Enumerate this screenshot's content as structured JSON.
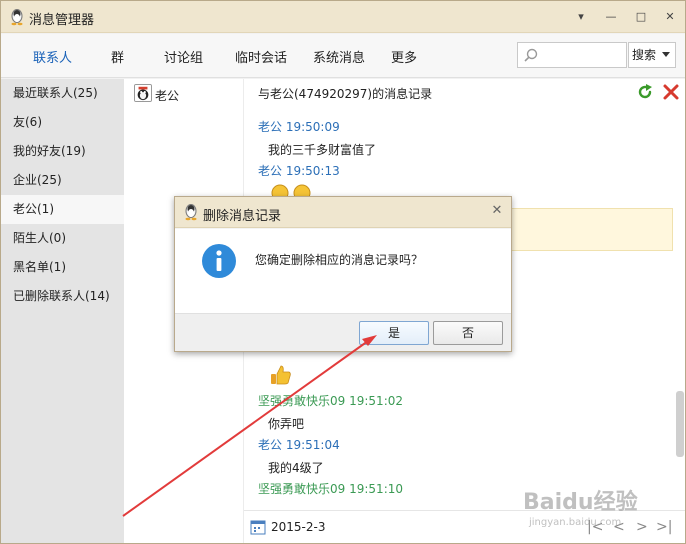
{
  "window": {
    "title": "消息管理器",
    "controls": {
      "dropdown": "▾",
      "minimize": "—",
      "maximize": "□",
      "close": "✕"
    }
  },
  "nav": {
    "tabs": [
      "联系人",
      "群",
      "讨论组",
      "临时会话",
      "系统消息",
      "更多"
    ],
    "active_tab": "联系人",
    "search_placeholder": "",
    "search_button": "搜索"
  },
  "sidebar": {
    "items": [
      "最近联系人(25)",
      "友(6)",
      "我的好友(19)",
      "企业(25)",
      "老公(1)",
      "陌生人(0)",
      "黑名单(1)",
      "已删除联系人(14)"
    ],
    "selected": "老公(1)"
  },
  "contacts": [
    {
      "name": "老公"
    }
  ],
  "chat": {
    "header": "与老公(474920297)的消息记录",
    "messages": [
      {
        "sender": "老公",
        "time": "19:50:09",
        "text": "我的三千多财富值了",
        "color": "#2c6fb7"
      },
      {
        "sender": "老公",
        "time": "19:50:13",
        "text": "",
        "emoji": "gift",
        "color": "#2c6fb7"
      },
      {
        "sender": "",
        "time": "",
        "text": "",
        "emoji": "thumbs-up",
        "color": ""
      },
      {
        "sender": "坚强勇敢快乐09",
        "time": "19:51:02",
        "text": "你弄吧",
        "color": "#3b9a54"
      },
      {
        "sender": "老公",
        "time": "19:51:04",
        "text": "我的4级了",
        "color": "#2c6fb7"
      },
      {
        "sender": "坚强勇敢快乐09",
        "time": "19:51:10",
        "text": "",
        "color": "#3b9a54"
      }
    ],
    "footer_date": "2015-2-3",
    "pager": {
      "first": "|<",
      "prev": "<",
      "next": ">",
      "last": ">|"
    }
  },
  "dialog": {
    "title": "删除消息记录",
    "close": "✕",
    "message": "您确定删除相应的消息记录吗？",
    "yes_label": "是",
    "no_label": "否"
  },
  "watermark": {
    "main": "Baidu经验",
    "sub": "jingyan.baidu.com"
  },
  "colors": {
    "accent": "#1a62b8",
    "annotation_arrow": "#e23b3b",
    "title_bar": "#efe6cf"
  }
}
